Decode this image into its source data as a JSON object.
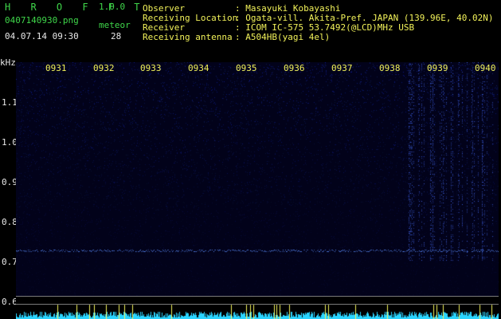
{
  "header": {
    "app_title": "H R O F F T",
    "version": "1.0.0",
    "filename": "0407140930.png",
    "datetime": "04.07.14 09:30",
    "meteor_label": "meteor",
    "meteor_count": "28"
  },
  "info": {
    "labels": [
      "Observer",
      "Receiving Location",
      "Receiver",
      "Receiving antenna"
    ],
    "values": [
      ": Masayuki Kobayashi",
      ": Ogata-vill. Akita-Pref. JAPAN (139.96E, 40.02N)",
      ": ICOM IC-575 53.7492(@LCD)MHz USB",
      ": A504HB(yagi 4el)"
    ]
  },
  "axis": {
    "unit": "kHz",
    "y_ticks": [
      "1.1",
      "1.0",
      "0.9",
      "0.8",
      "0.7",
      "0.6"
    ],
    "y_tick_values": [
      1.1,
      1.0,
      0.9,
      0.8,
      0.7,
      0.6
    ],
    "time_ticks": [
      "0931",
      "0932",
      "0933",
      "0934",
      "0935",
      "0936",
      "0937",
      "0938",
      "0939",
      "0940"
    ]
  },
  "colors": {
    "background": "#000000",
    "label_green": "#3fd64a",
    "tick_yellow": "#f2f25a",
    "noise_blue": "#2a3cff",
    "trace_cyan": "#33e0ff"
  }
}
